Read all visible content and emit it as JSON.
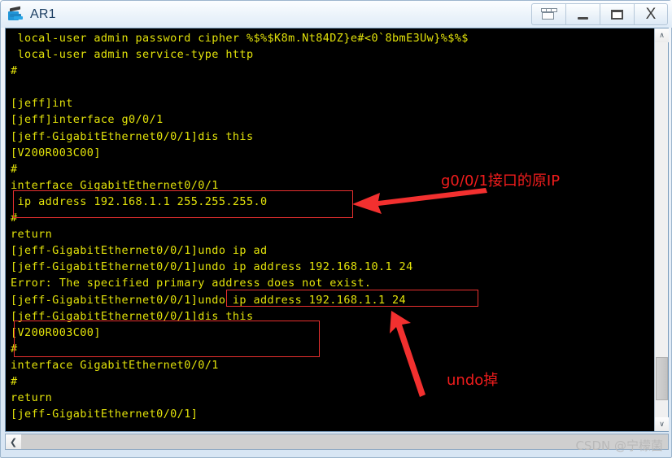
{
  "window": {
    "title": "AR1",
    "icon": "router-icon",
    "buttons": [
      {
        "name": "restore-down-button",
        "icon": "restore-icon",
        "label": ""
      },
      {
        "name": "minimize-button",
        "icon": "minimize-icon",
        "label": ""
      },
      {
        "name": "maximize-button",
        "icon": "maximize-icon",
        "label": ""
      },
      {
        "name": "close-button",
        "icon": "close-icon",
        "label": "X"
      }
    ]
  },
  "terminal": {
    "foreground_color": "#e2e20a",
    "background_color": "#000000",
    "lines": [
      " local-user admin password cipher %$%$K8m.Nt84DZ}e#<0`8bmE3Uw}%$%$",
      " local-user admin service-type http",
      "#",
      "",
      "[jeff]int",
      "[jeff]interface g0/0/1",
      "[jeff-GigabitEthernet0/0/1]dis this",
      "[V200R003C00]",
      "#",
      "interface GigabitEthernet0/0/1",
      " ip address 192.168.1.1 255.255.255.0",
      "#",
      "return",
      "[jeff-GigabitEthernet0/0/1]undo ip ad",
      "[jeff-GigabitEthernet0/0/1]undo ip address 192.168.10.1 24",
      "Error: The specified primary address does not exist.",
      "[jeff-GigabitEthernet0/0/1]undo ip address 192.168.1.1 24",
      "[jeff-GigabitEthernet0/0/1]dis this",
      "[V200R003C00]",
      "#",
      "interface GigabitEthernet0/0/1",
      "#",
      "return",
      "[jeff-GigabitEthernet0/0/1]"
    ]
  },
  "annotations": {
    "color": "#f01c1c",
    "callouts": [
      {
        "name": "original-ip-callout",
        "text": "g0/0/1接口的原IP"
      },
      {
        "name": "undo-callout",
        "text": "undo掉"
      }
    ]
  },
  "scrollbars": {
    "vertical": {
      "up_glyph": "∧",
      "down_glyph": "∨"
    },
    "horizontal": {
      "left_glyph": "❮"
    }
  },
  "watermark": {
    "text": "CSDN @宁檬菌"
  }
}
